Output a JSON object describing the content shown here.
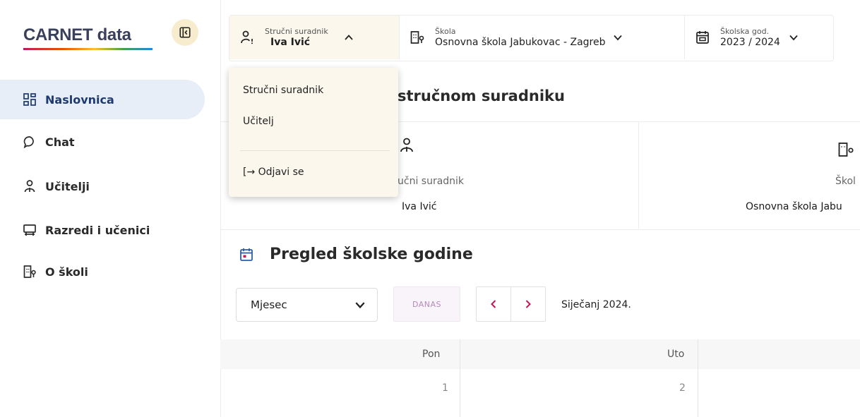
{
  "sidebar": {
    "logo": "CARNET data",
    "items": [
      {
        "label": "Naslovnica",
        "icon": "dashboard-icon",
        "active": true
      },
      {
        "label": "Chat",
        "icon": "chat-icon"
      },
      {
        "label": "Učitelji",
        "icon": "teacher-icon"
      },
      {
        "label": "Razredi i učenici",
        "icon": "classroom-icon"
      },
      {
        "label": "O školi",
        "icon": "school-icon"
      }
    ]
  },
  "header": {
    "role": {
      "label": "Stručni suradnik",
      "value": "Iva Ivić"
    },
    "school": {
      "label": "Škola",
      "value": "Osnovna škola Jabukovac - Zagreb"
    },
    "year": {
      "label": "Školska god.",
      "value": "2023 / 2024"
    }
  },
  "role_menu": {
    "items": [
      "Stručni suradnik",
      "Učitelj"
    ],
    "logout": "[→ Odjavi se"
  },
  "info_card": {
    "title": "stručnom suradniku",
    "role_label": "učni suradnik",
    "role_value": "Iva Ivić",
    "school_label": "Škol",
    "school_value": "Osnovna škola Jabu"
  },
  "year_overview": {
    "title": "Pregled školske godine",
    "view_select": "Mjesec",
    "today_button": "DANAS",
    "current_month": "Siječanj 2024.",
    "day_headers": [
      "Pon",
      "Uto"
    ],
    "day_numbers": [
      "1",
      "2"
    ]
  },
  "colors": {
    "accent": "#f7eccd",
    "active_nav": "#e8eef8",
    "menu_bg": "#fbf7ec",
    "today_text": "#b48ab8"
  }
}
